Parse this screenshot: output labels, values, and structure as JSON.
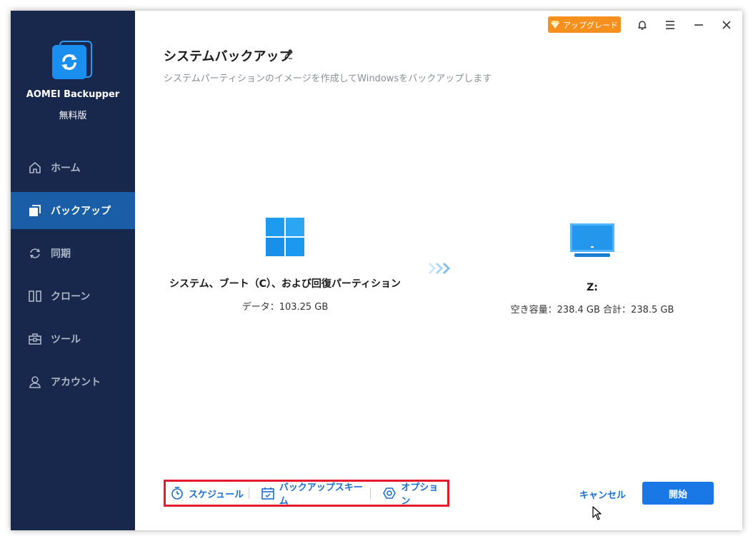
{
  "app": {
    "name": "AOMEI Backupper",
    "edition": "無料版"
  },
  "sidebar": {
    "items": [
      {
        "id": "home",
        "label": "ホーム",
        "icon": "home-icon",
        "active": false
      },
      {
        "id": "backup",
        "label": "バックアップ",
        "icon": "backup-icon",
        "active": true
      },
      {
        "id": "sync",
        "label": "同期",
        "icon": "sync-icon",
        "active": false
      },
      {
        "id": "clone",
        "label": "クローン",
        "icon": "clone-icon",
        "active": false
      },
      {
        "id": "tools",
        "label": "ツール",
        "icon": "toolbox-icon",
        "active": false
      },
      {
        "id": "account",
        "label": "アカウント",
        "icon": "user-icon",
        "active": false
      }
    ]
  },
  "header": {
    "upgrade_label": "アップグレード"
  },
  "page": {
    "title": "システムバックアップ",
    "subtitle": "システムパーティションのイメージを作成してWindowsをバックアップします"
  },
  "source": {
    "name": "システム、ブート（C）、および回復パーティション",
    "data": "データ：103.25 GB"
  },
  "destination": {
    "name": "Z:",
    "space": "空き容量：238.4 GB 合計：238.5 GB"
  },
  "footer": {
    "schedule_label": "スケジュール",
    "scheme_label": "バックアップスキーム",
    "options_label": "オプション",
    "cancel_label": "キャンセル",
    "start_label": "開始"
  },
  "colors": {
    "sidebar_bg": "#17284c",
    "active_nav": "#1a5ea8",
    "accent": "#1a78e6",
    "upgrade": "#f5901e",
    "highlight_border": "#e51a2c"
  }
}
